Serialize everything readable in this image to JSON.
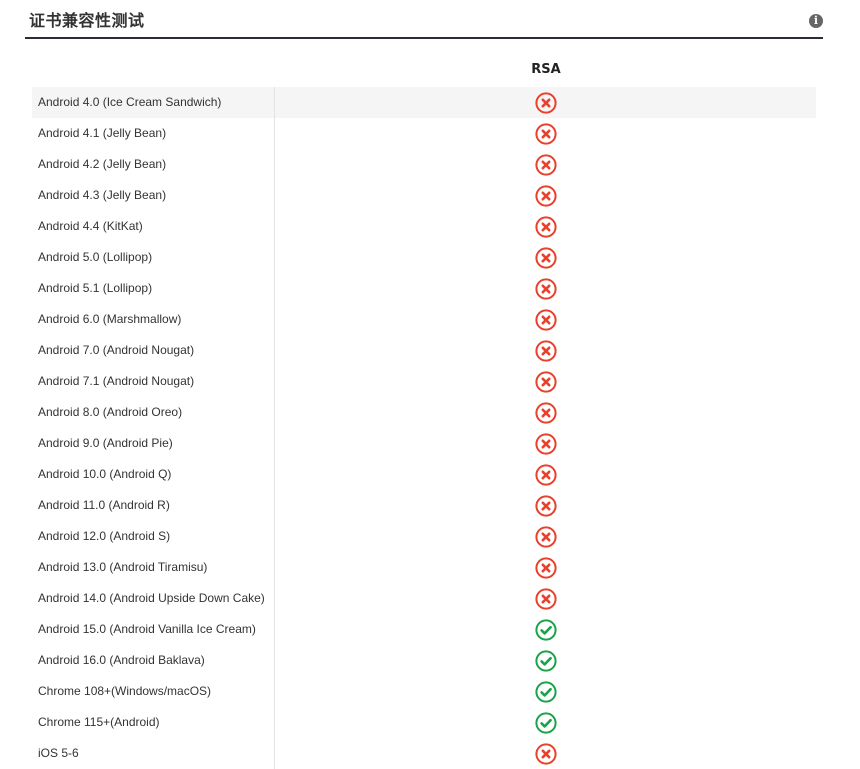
{
  "panel": {
    "title": "证书兼容性测试",
    "info_icon": "info-icon"
  },
  "table": {
    "column_header": "RSA",
    "colors": {
      "fail": "#e8412c",
      "pass": "#1aa34a"
    },
    "rows": [
      {
        "label": "Android 4.0 (Ice Cream Sandwich)",
        "rsa": "fail"
      },
      {
        "label": "Android 4.1 (Jelly Bean)",
        "rsa": "fail"
      },
      {
        "label": "Android 4.2 (Jelly Bean)",
        "rsa": "fail"
      },
      {
        "label": "Android 4.3 (Jelly Bean)",
        "rsa": "fail"
      },
      {
        "label": "Android 4.4 (KitKat)",
        "rsa": "fail"
      },
      {
        "label": "Android 5.0 (Lollipop)",
        "rsa": "fail"
      },
      {
        "label": "Android 5.1 (Lollipop)",
        "rsa": "fail"
      },
      {
        "label": "Android 6.0 (Marshmallow)",
        "rsa": "fail"
      },
      {
        "label": "Android 7.0 (Android Nougat)",
        "rsa": "fail"
      },
      {
        "label": "Android 7.1 (Android Nougat)",
        "rsa": "fail"
      },
      {
        "label": "Android 8.0 (Android Oreo)",
        "rsa": "fail"
      },
      {
        "label": "Android 9.0 (Android Pie)",
        "rsa": "fail"
      },
      {
        "label": "Android 10.0 (Android Q)",
        "rsa": "fail"
      },
      {
        "label": "Android 11.0 (Android R)",
        "rsa": "fail"
      },
      {
        "label": "Android 12.0 (Android S)",
        "rsa": "fail"
      },
      {
        "label": "Android 13.0 (Android Tiramisu)",
        "rsa": "fail"
      },
      {
        "label": "Android 14.0 (Android Upside Down Cake)",
        "rsa": "fail"
      },
      {
        "label": "Android 15.0 (Android Vanilla Ice Cream)",
        "rsa": "pass"
      },
      {
        "label": "Android 16.0 (Android Baklava)",
        "rsa": "pass"
      },
      {
        "label": "Chrome 108+(Windows/macOS)",
        "rsa": "pass"
      },
      {
        "label": "Chrome 115+(Android)",
        "rsa": "pass"
      },
      {
        "label": "iOS 5-6",
        "rsa": "fail"
      }
    ]
  }
}
